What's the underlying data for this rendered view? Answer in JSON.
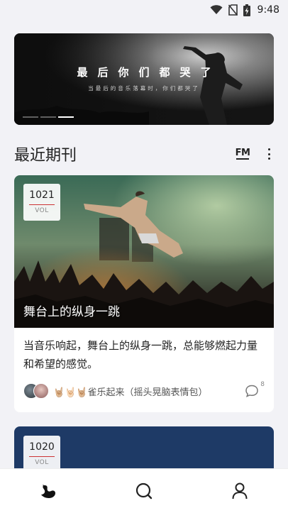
{
  "status_bar": {
    "time": "9:48",
    "icons": [
      "wifi-icon",
      "no-sim-icon",
      "battery-charging-icon"
    ]
  },
  "banner": {
    "title": "最后你们都哭了",
    "subtitle": "当最后的音乐落幕时，你们都哭了",
    "dot_count": 3,
    "active_dot": 2
  },
  "section": {
    "title": "最近期刊",
    "fm_label": "FM",
    "icons": [
      "fm-icon",
      "more-vertical-icon"
    ]
  },
  "cards": [
    {
      "vol_number": "1021",
      "vol_label": "VOL",
      "title": "舞台上的纵身一跳",
      "description": "当音乐响起，舞台上的纵身一跳，总能够燃起力量和希望的感觉。",
      "meta": "🤘🏼🤘🏻🤘🏼雀乐起来（摇头晃脑表情包）",
      "comment_count": "8"
    },
    {
      "vol_number": "1020",
      "vol_label": "VOL"
    }
  ],
  "bottom_nav": {
    "items": [
      "home-swan-icon",
      "search-icon",
      "profile-icon"
    ]
  },
  "colors": {
    "page_background": "#f2f2f6",
    "card_background": "#ffffff",
    "accent_line": "#cc3333",
    "second_card_background": "#1e3a66"
  }
}
